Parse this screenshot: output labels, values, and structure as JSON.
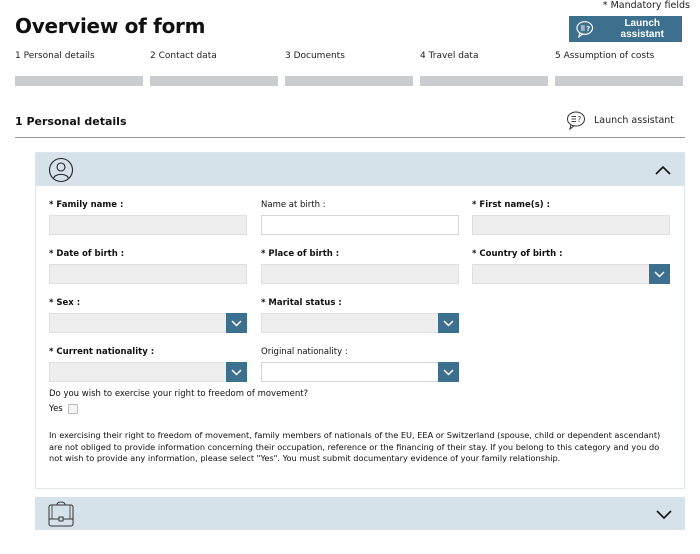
{
  "header": {
    "mandatory_note": "* Mandatory fields",
    "title": "Overview of form",
    "launch_assistant_label": "Launch assistant"
  },
  "steps": [
    {
      "label": "1 Personal details"
    },
    {
      "label": "2 Contact data"
    },
    {
      "label": "3 Documents"
    },
    {
      "label": "4 Travel data"
    },
    {
      "label": "5 Assumption of costs"
    }
  ],
  "section": {
    "title": "1 Personal details",
    "assistant_label": "Launch assistant"
  },
  "panels": [
    {
      "icon": "person-icon",
      "state": "expanded"
    },
    {
      "icon": "briefcase-icon",
      "state": "collapsed"
    }
  ],
  "fields": {
    "family_name": {
      "label": "* Family name :",
      "value": ""
    },
    "name_at_birth": {
      "label": "Name at birth :",
      "value": ""
    },
    "first_names": {
      "label": "* First name(s) :",
      "value": ""
    },
    "date_of_birth": {
      "label": "* Date of birth :",
      "value": ""
    },
    "place_of_birth": {
      "label": "* Place of birth :",
      "value": ""
    },
    "country_of_birth": {
      "label": "* Country of birth :",
      "value": ""
    },
    "sex": {
      "label": "* Sex :",
      "value": ""
    },
    "marital_status": {
      "label": "* Marital status :",
      "value": ""
    },
    "current_nationality": {
      "label": "* Current nationality :",
      "value": ""
    },
    "original_nationality": {
      "label": "Original nationality :",
      "value": ""
    }
  },
  "freedom": {
    "question": "Do you wish to exercise your right to freedom of movement?",
    "yes_label": "Yes",
    "yes_checked": false,
    "info": "In exercising their right to freedom of movement, family members of nationals of the EU, EEA or Switzerland (spouse, child or dependent ascendant) are not obliged to provide information concerning their occupation, reference or the financing of their stay. If you belong to this category and you do not wish to provide any information, please select \"Yes\". You must submit documentary evidence of your family relationship."
  },
  "colors": {
    "accent": "#3d6f8f",
    "panel_header": "#d5e2ea",
    "step_bar": "#c9cdd0",
    "disabled_field": "#eeeeee"
  }
}
